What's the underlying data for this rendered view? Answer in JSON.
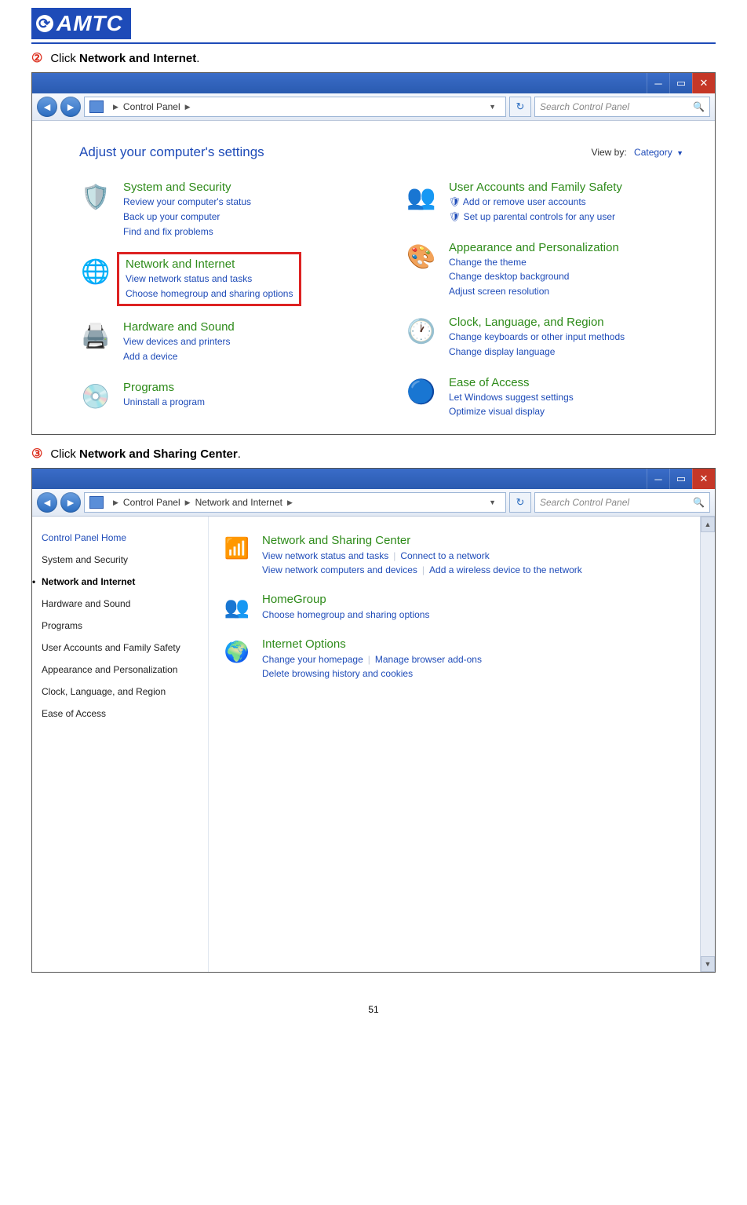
{
  "logo_text": "AMTC",
  "step2": {
    "num": "②",
    "prefix": "Click ",
    "bold": "Network and Internet",
    "suffix": "."
  },
  "step3": {
    "num": "③",
    "prefix": "Click ",
    "bold": "Network and Sharing Center",
    "suffix": "."
  },
  "page_number": "51",
  "shot1": {
    "breadcrumb": [
      "Control Panel"
    ],
    "search_placeholder": "Search Control Panel",
    "adjust_title": "Adjust your computer's settings",
    "viewby_label": "View by:",
    "viewby_value": "Category",
    "left": [
      {
        "title": "System and Security",
        "links": [
          "Review your computer's status",
          "Back up your computer",
          "Find and fix problems"
        ],
        "icon": "🛡️"
      },
      {
        "title": "Network and Internet",
        "links": [
          "View network status and tasks",
          "Choose homegroup and sharing options"
        ],
        "icon": "🌐",
        "hl": true
      },
      {
        "title": "Hardware and Sound",
        "links": [
          "View devices and printers",
          "Add a device"
        ],
        "icon": "🖨️"
      },
      {
        "title": "Programs",
        "links": [
          "Uninstall a program"
        ],
        "icon": "💿"
      }
    ],
    "right": [
      {
        "title": "User Accounts and Family Safety",
        "links": [
          "Add or remove user accounts",
          "Set up parental controls for any user"
        ],
        "icon": "👥",
        "link_icons": true
      },
      {
        "title": "Appearance and Personalization",
        "links": [
          "Change the theme",
          "Change desktop background",
          "Adjust screen resolution"
        ],
        "icon": "🎨"
      },
      {
        "title": "Clock, Language, and Region",
        "links": [
          "Change keyboards or other input methods",
          "Change display language"
        ],
        "icon": "🕐"
      },
      {
        "title": "Ease of Access",
        "links": [
          "Let Windows suggest settings",
          "Optimize visual display"
        ],
        "icon": "🔵"
      }
    ]
  },
  "shot2": {
    "breadcrumb": [
      "Control Panel",
      "Network and Internet"
    ],
    "search_placeholder": "Search Control Panel",
    "side_home": "Control Panel Home",
    "side": [
      {
        "label": "System and Security"
      },
      {
        "label": "Network and Internet",
        "active": true
      },
      {
        "label": "Hardware and Sound"
      },
      {
        "label": "Programs"
      },
      {
        "label": "User Accounts and Family Safety"
      },
      {
        "label": "Appearance and Personalization"
      },
      {
        "label": "Clock, Language, and Region"
      },
      {
        "label": "Ease of Access"
      }
    ],
    "items": [
      {
        "title": "Network and Sharing Center",
        "icon": "📶",
        "rows": [
          [
            "View network status and tasks",
            "Connect to a network"
          ],
          [
            "View network computers and devices",
            "Add a wireless device to the network"
          ]
        ]
      },
      {
        "title": "HomeGroup",
        "icon": "👥",
        "rows": [
          [
            "Choose homegroup and sharing options"
          ]
        ]
      },
      {
        "title": "Internet Options",
        "icon": "🌍",
        "rows": [
          [
            "Change your homepage",
            "Manage browser add-ons"
          ],
          [
            "Delete browsing history and cookies"
          ]
        ]
      }
    ]
  }
}
